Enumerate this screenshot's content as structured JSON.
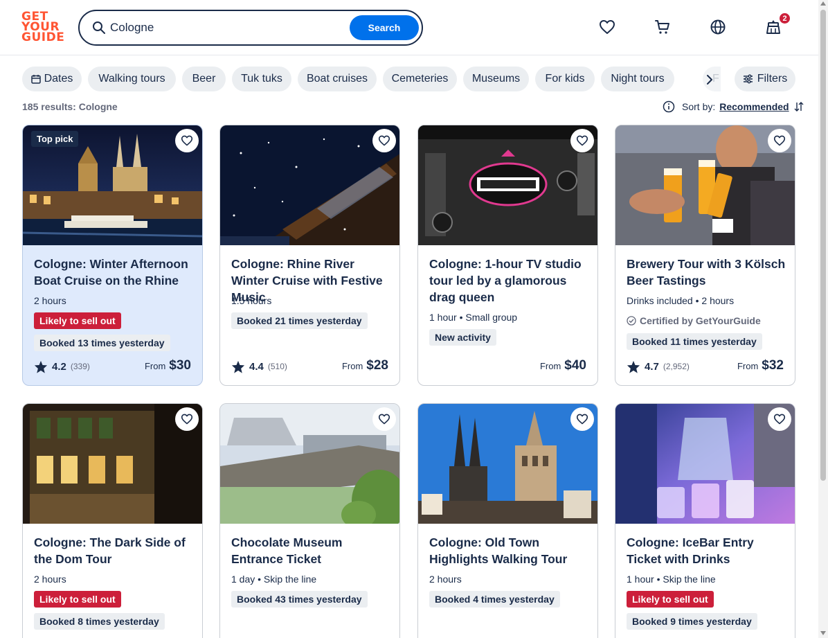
{
  "header": {
    "logo_lines": [
      "GET",
      "YOUR",
      "GUIDE"
    ],
    "search_value": "Cologne",
    "search_button": "Search",
    "notification_count": "2"
  },
  "chips": [
    "Dates",
    "Walking tours",
    "Beer",
    "Tuk tuks",
    "Boat cruises",
    "Cemeteries",
    "Museums",
    "For kids",
    "Night tours"
  ],
  "chip_overflow": "F",
  "filters_label": "Filters",
  "results_text": "185 results: Cologne",
  "sort": {
    "label": "Sort by:",
    "value": "Recommended"
  },
  "cards": [
    {
      "title": "Cologne: Winter Afternoon Boat Cruise on the Rhine",
      "badge": "Top pick",
      "meta": "2 hours",
      "red_tag": "Likely to sell out",
      "grey_tag": "Booked 13 times yesterday",
      "rating": "4.2",
      "reviews": "(339)",
      "from": "From",
      "price": "$30"
    },
    {
      "title": "Cologne: Rhine River Winter Cruise with Festive Music",
      "meta": "1.5 hours",
      "grey_tag": "Booked 21 times yesterday",
      "rating": "4.4",
      "reviews": "(510)",
      "from": "From",
      "price": "$28"
    },
    {
      "title": "Cologne: 1-hour TV studio tour led by a glamorous drag queen",
      "meta": "1 hour • Small group",
      "grey_tag": "New activity",
      "from": "From",
      "price": "$40"
    },
    {
      "title": "Brewery Tour with 3 Kölsch Beer Tastings",
      "meta": "Drinks included • 2 hours",
      "certified": "Certified by GetYourGuide",
      "grey_tag": "Booked 11 times yesterday",
      "rating": "4.7",
      "reviews": "(2,952)",
      "from": "From",
      "price": "$32"
    },
    {
      "title": "Cologne: The Dark Side of the Dom Tour",
      "meta": "2 hours",
      "red_tag": "Likely to sell out",
      "grey_tag": "Booked 8 times yesterday"
    },
    {
      "title": "Chocolate Museum Entrance Ticket",
      "meta": "1 day • Skip the line",
      "grey_tag": "Booked 43 times yesterday"
    },
    {
      "title": "Cologne: Old Town Highlights Walking Tour",
      "meta": "2 hours",
      "grey_tag": "Booked 4 times yesterday"
    },
    {
      "title": "Cologne: IceBar Entry Ticket with Drinks",
      "meta": "1 hour • Skip the line",
      "red_tag": "Likely to sell out",
      "grey_tag": "Booked 9 times yesterday"
    }
  ],
  "colors": {
    "brand": "#ff5533",
    "primary": "#0071eb",
    "navy": "#1a2b49",
    "red_tag": "#cc1f3a",
    "highlight": "#dfeafc"
  }
}
